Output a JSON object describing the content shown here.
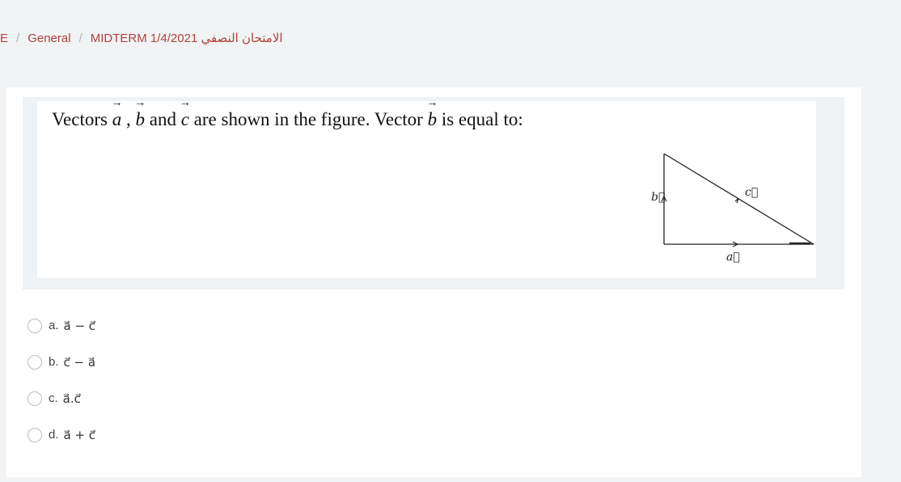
{
  "breadcrumb": {
    "item0": "E",
    "item1": "General",
    "item2": "MIDTERM 1/4/2021 الامتحان النصفي"
  },
  "question": {
    "part1": "Vectors ",
    "vec_a": "a",
    "sep1": " , ",
    "vec_b": "b",
    "part2": " and ",
    "vec_c": "c",
    "part3": " are shown in the figure. Vector ",
    "vec_b2": "b",
    "part4": " is equal to:",
    "figure_labels": {
      "a": "a⃗",
      "b": "b⃗",
      "c": "c⃗"
    }
  },
  "answers": [
    {
      "letter": "a.",
      "expr": "a⃗ − c⃗"
    },
    {
      "letter": "b.",
      "expr": "c⃗ − a⃗"
    },
    {
      "letter": "c.",
      "expr": "a⃗.c⃗"
    },
    {
      "letter": "d.",
      "expr": "a⃗ + c⃗"
    }
  ]
}
